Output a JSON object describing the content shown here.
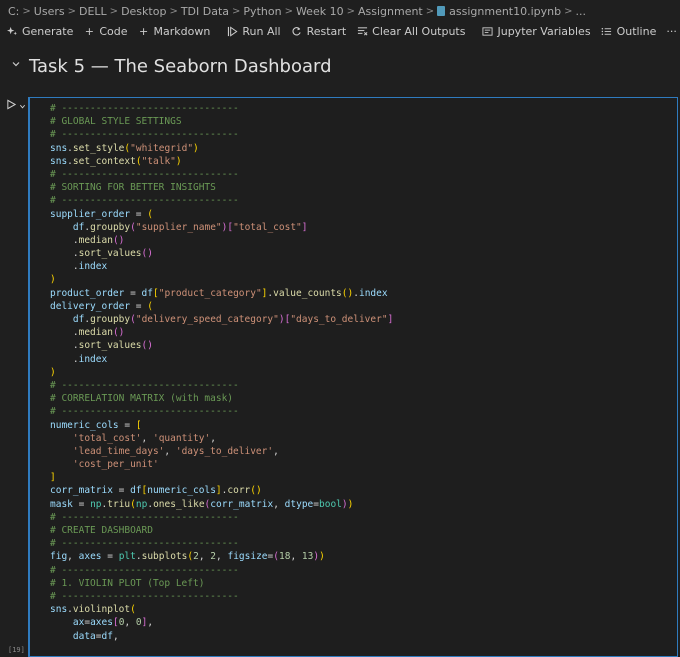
{
  "breadcrumb": {
    "items": [
      "C:",
      "Users",
      "DELL",
      "Desktop",
      "TDI Data",
      "Python",
      "Week 10",
      "Assignment",
      "assignment10.ipynb",
      "..."
    ]
  },
  "toolbar": {
    "generate": "Generate",
    "code": "Code",
    "markdown": "Markdown",
    "run_all": "Run All",
    "restart": "Restart",
    "clear_all": "Clear All Outputs",
    "jupyter_vars": "Jupyter Variables",
    "outline": "Outline",
    "more": "···"
  },
  "markdown_cell": {
    "title": "Task 5 — The Seaborn Dashboard"
  },
  "code_cell": {
    "execution_count": "[19]",
    "lines": [
      [
        [
          "c",
          "# -------------------------------"
        ]
      ],
      [
        [
          "c",
          "# GLOBAL STYLE SETTINGS"
        ]
      ],
      [
        [
          "c",
          "# -------------------------------"
        ]
      ],
      [
        [
          "v",
          "sns"
        ],
        [
          "w",
          "."
        ],
        [
          "f",
          "set_style"
        ],
        [
          "p",
          "("
        ],
        [
          "s",
          "\"whitegrid\""
        ],
        [
          "p",
          ")"
        ]
      ],
      [
        [
          "v",
          "sns"
        ],
        [
          "w",
          "."
        ],
        [
          "f",
          "set_context"
        ],
        [
          "p",
          "("
        ],
        [
          "s",
          "\"talk\""
        ],
        [
          "p",
          ")"
        ]
      ],
      [
        [
          "c",
          "# -------------------------------"
        ]
      ],
      [
        [
          "c",
          "# SORTING FOR BETTER INSIGHTS"
        ]
      ],
      [
        [
          "c",
          "# -------------------------------"
        ]
      ],
      [
        [
          "v",
          "supplier_order"
        ],
        [
          "w",
          " = "
        ],
        [
          "p",
          "("
        ]
      ],
      [
        [
          "w",
          "    "
        ],
        [
          "v",
          "df"
        ],
        [
          "w",
          "."
        ],
        [
          "f",
          "groupby"
        ],
        [
          "p2",
          "("
        ],
        [
          "s",
          "\"supplier_name\""
        ],
        [
          "p2",
          ")"
        ],
        [
          "p2",
          "["
        ],
        [
          "s",
          "\"total_cost\""
        ],
        [
          "p2",
          "]"
        ]
      ],
      [
        [
          "w",
          "    ."
        ],
        [
          "f",
          "median"
        ],
        [
          "p2",
          "()"
        ]
      ],
      [
        [
          "w",
          "    ."
        ],
        [
          "f",
          "sort_values"
        ],
        [
          "p2",
          "()"
        ]
      ],
      [
        [
          "w",
          "    ."
        ],
        [
          "v",
          "index"
        ]
      ],
      [
        [
          "p",
          ")"
        ]
      ],
      [
        [
          "v",
          "product_order"
        ],
        [
          "w",
          " = "
        ],
        [
          "v",
          "df"
        ],
        [
          "p",
          "["
        ],
        [
          "s",
          "\"product_category\""
        ],
        [
          "p",
          "]"
        ],
        [
          "w",
          "."
        ],
        [
          "f",
          "value_counts"
        ],
        [
          "p",
          "()"
        ],
        [
          "w",
          "."
        ],
        [
          "v",
          "index"
        ]
      ],
      [
        [
          "v",
          "delivery_order"
        ],
        [
          "w",
          " = "
        ],
        [
          "p",
          "("
        ]
      ],
      [
        [
          "w",
          "    "
        ],
        [
          "v",
          "df"
        ],
        [
          "w",
          "."
        ],
        [
          "f",
          "groupby"
        ],
        [
          "p2",
          "("
        ],
        [
          "s",
          "\"delivery_speed_category\""
        ],
        [
          "p2",
          ")"
        ],
        [
          "p2",
          "["
        ],
        [
          "s",
          "\"days_to_deliver\""
        ],
        [
          "p2",
          "]"
        ]
      ],
      [
        [
          "w",
          "    ."
        ],
        [
          "f",
          "median"
        ],
        [
          "p2",
          "()"
        ]
      ],
      [
        [
          "w",
          "    ."
        ],
        [
          "f",
          "sort_values"
        ],
        [
          "p2",
          "()"
        ]
      ],
      [
        [
          "w",
          "    ."
        ],
        [
          "v",
          "index"
        ]
      ],
      [
        [
          "p",
          ")"
        ]
      ],
      [
        [
          "c",
          "# -------------------------------"
        ]
      ],
      [
        [
          "c",
          "# CORRELATION MATRIX (with mask)"
        ]
      ],
      [
        [
          "c",
          "# -------------------------------"
        ]
      ],
      [
        [
          "v",
          "numeric_cols"
        ],
        [
          "w",
          " = "
        ],
        [
          "p",
          "["
        ]
      ],
      [
        [
          "w",
          "    "
        ],
        [
          "s",
          "'total_cost'"
        ],
        [
          "w",
          ", "
        ],
        [
          "s",
          "'quantity'"
        ],
        [
          "w",
          ","
        ]
      ],
      [
        [
          "w",
          "    "
        ],
        [
          "s",
          "'lead_time_days'"
        ],
        [
          "w",
          ", "
        ],
        [
          "s",
          "'days_to_deliver'"
        ],
        [
          "w",
          ","
        ]
      ],
      [
        [
          "w",
          "    "
        ],
        [
          "s",
          "'cost_per_unit'"
        ]
      ],
      [
        [
          "p",
          "]"
        ]
      ],
      [
        [
          "v",
          "corr_matrix"
        ],
        [
          "w",
          " = "
        ],
        [
          "v",
          "df"
        ],
        [
          "p",
          "["
        ],
        [
          "v",
          "numeric_cols"
        ],
        [
          "p",
          "]"
        ],
        [
          "w",
          "."
        ],
        [
          "f",
          "corr"
        ],
        [
          "p",
          "()"
        ]
      ],
      [
        [
          "v",
          "mask"
        ],
        [
          "w",
          " = "
        ],
        [
          "t",
          "np"
        ],
        [
          "w",
          "."
        ],
        [
          "f",
          "triu"
        ],
        [
          "p",
          "("
        ],
        [
          "t",
          "np"
        ],
        [
          "w",
          "."
        ],
        [
          "f",
          "ones_like"
        ],
        [
          "p2",
          "("
        ],
        [
          "v",
          "corr_matrix"
        ],
        [
          "w",
          ", "
        ],
        [
          "v",
          "dtype"
        ],
        [
          "w",
          "="
        ],
        [
          "t",
          "bool"
        ],
        [
          "p2",
          ")"
        ],
        [
          "p",
          ")"
        ]
      ],
      [
        [
          "c",
          "# -------------------------------"
        ]
      ],
      [
        [
          "c",
          "# CREATE DASHBOARD"
        ]
      ],
      [
        [
          "c",
          "# -------------------------------"
        ]
      ],
      [
        [
          "v",
          "fig"
        ],
        [
          "w",
          ", "
        ],
        [
          "v",
          "axes"
        ],
        [
          "w",
          " = "
        ],
        [
          "t",
          "plt"
        ],
        [
          "w",
          "."
        ],
        [
          "f",
          "subplots"
        ],
        [
          "p",
          "("
        ],
        [
          "n",
          "2"
        ],
        [
          "w",
          ", "
        ],
        [
          "n",
          "2"
        ],
        [
          "w",
          ", "
        ],
        [
          "v",
          "figsize"
        ],
        [
          "w",
          "="
        ],
        [
          "p2",
          "("
        ],
        [
          "n",
          "18"
        ],
        [
          "w",
          ", "
        ],
        [
          "n",
          "13"
        ],
        [
          "p2",
          ")"
        ],
        [
          "p",
          ")"
        ]
      ],
      [
        [
          "c",
          "# -------------------------------"
        ]
      ],
      [
        [
          "c",
          "# 1. VIOLIN PLOT (Top Left)"
        ]
      ],
      [
        [
          "c",
          "# -------------------------------"
        ]
      ],
      [
        [
          "v",
          "sns"
        ],
        [
          "w",
          "."
        ],
        [
          "f",
          "violinplot"
        ],
        [
          "p",
          "("
        ]
      ],
      [
        [
          "w",
          "    "
        ],
        [
          "v",
          "ax"
        ],
        [
          "w",
          "="
        ],
        [
          "v",
          "axes"
        ],
        [
          "p2",
          "["
        ],
        [
          "n",
          "0"
        ],
        [
          "w",
          ", "
        ],
        [
          "n",
          "0"
        ],
        [
          "p2",
          "]"
        ],
        [
          "w",
          ","
        ]
      ],
      [
        [
          "w",
          "    "
        ],
        [
          "v",
          "data"
        ],
        [
          "w",
          "="
        ],
        [
          "v",
          "df"
        ],
        [
          "w",
          ","
        ]
      ]
    ]
  }
}
